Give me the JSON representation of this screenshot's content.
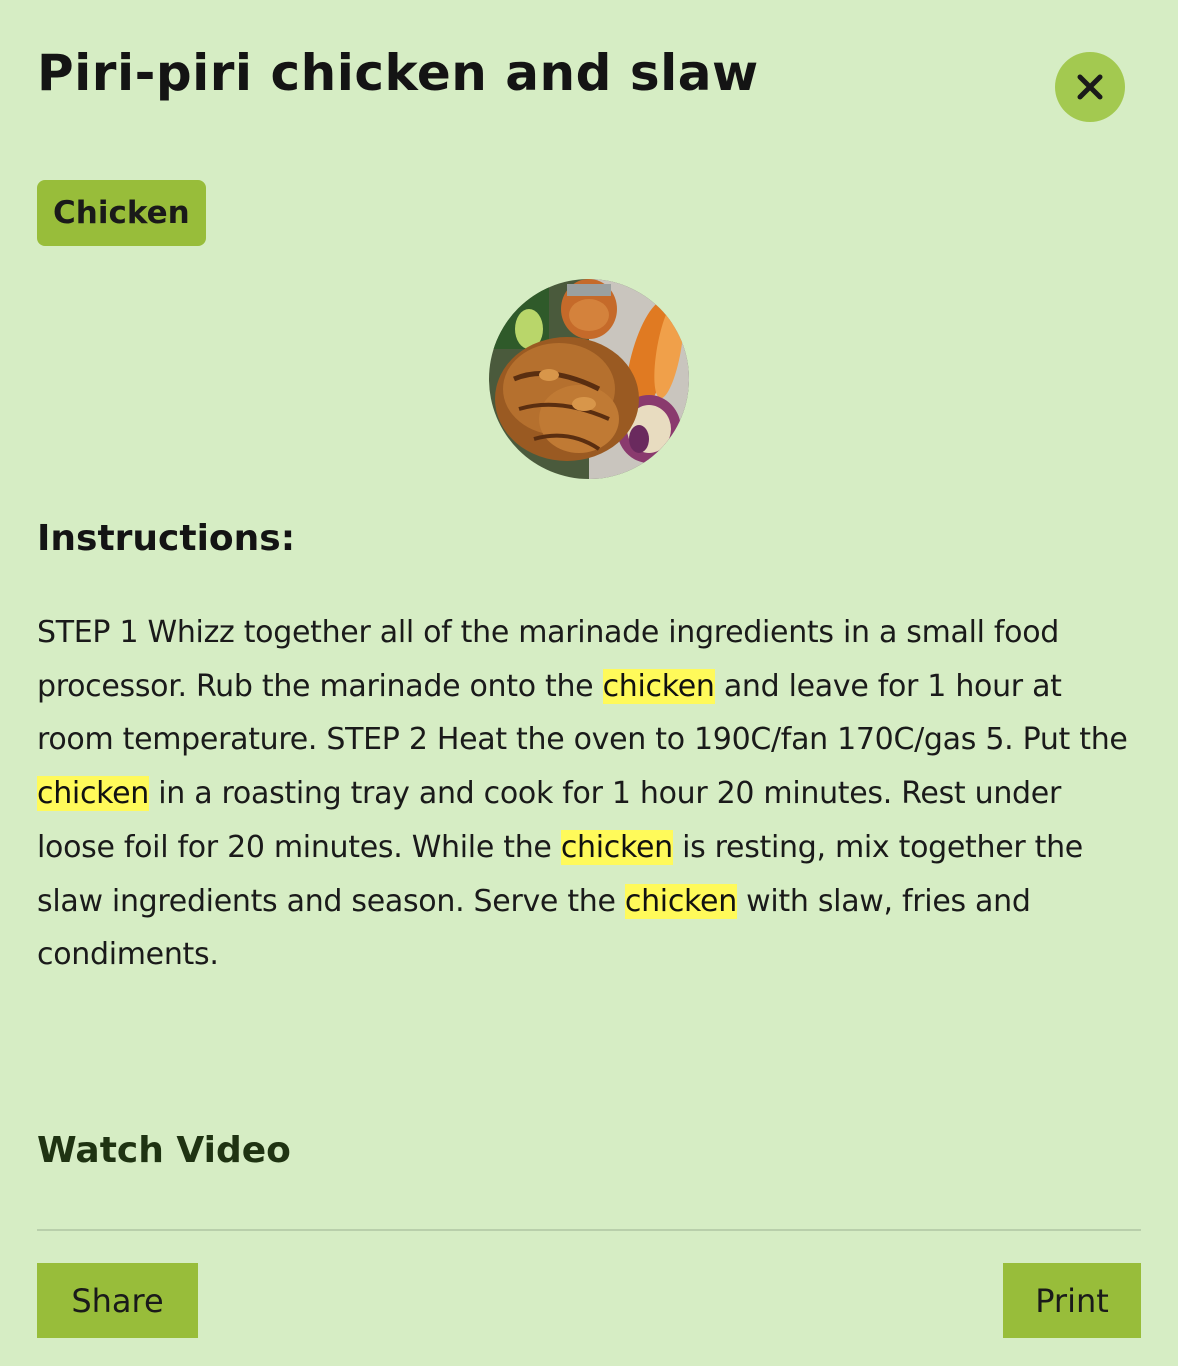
{
  "recipe": {
    "title": "Piri-piri chicken and slaw",
    "category_tag": "Chicken",
    "image_alt": "Piri-piri chicken and slaw"
  },
  "instructions": {
    "heading": "Instructions:",
    "highlight_term": "chicken",
    "text": "STEP 1 Whizz together all of the marinade ingredients in a small food processor. Rub the marinade onto the chicken and leave for 1 hour at room temperature. STEP 2 Heat the oven to 190C/fan 170C/gas 5. Put the chicken in a roasting tray and cook for 1 hour 20 minutes. Rest under loose foil for 20 minutes. While the chicken is resting, mix together the slaw ingredients and season. Serve the chicken with slaw, fries and condiments."
  },
  "links": {
    "watch_video": "Watch Video"
  },
  "footer": {
    "share_label": "Share",
    "print_label": "Print"
  },
  "icons": {
    "close": "close-icon"
  },
  "colors": {
    "background": "#d6edc4",
    "accent": "#98bd3a",
    "close_button": "#a3c950",
    "highlight": "#fffa5a"
  }
}
